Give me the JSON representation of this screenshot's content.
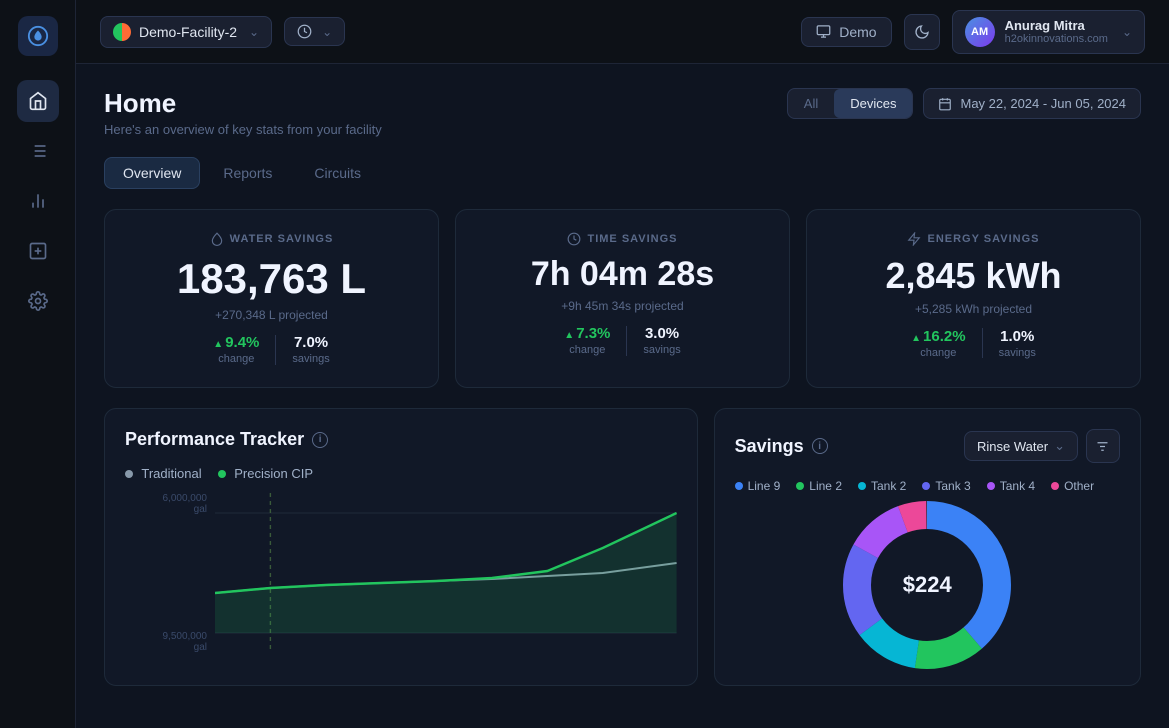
{
  "sidebar": {
    "logo_label": "H2O",
    "items": [
      {
        "name": "home",
        "icon": "home",
        "active": true
      },
      {
        "name": "list",
        "icon": "list",
        "active": false
      },
      {
        "name": "analytics",
        "icon": "bar-chart",
        "active": false
      },
      {
        "name": "add-square",
        "icon": "plus-square",
        "active": false
      },
      {
        "name": "settings",
        "icon": "settings",
        "active": false
      }
    ]
  },
  "topnav": {
    "facility_name": "Demo-Facility-2",
    "history_label": "History",
    "demo_label": "Demo",
    "user_name": "Anurag Mitra",
    "user_email": "h2okinnovations.com",
    "user_initials": "AM"
  },
  "page": {
    "title": "Home",
    "subtitle": "Here's an overview of key stats from your facility"
  },
  "filter": {
    "all_label": "All",
    "devices_label": "Devices",
    "date_range": "May 22, 2024 - Jun 05, 2024"
  },
  "tabs": [
    {
      "label": "Overview",
      "active": true
    },
    {
      "label": "Reports",
      "active": false
    },
    {
      "label": "Circuits",
      "active": false
    }
  ],
  "stats": {
    "water": {
      "icon_label": "droplet-icon",
      "label": "WATER SAVINGS",
      "value": "183,763 L",
      "projected": "+270,348 L projected",
      "change_value": "9.4%",
      "change_label": "change",
      "savings_value": "7.0%",
      "savings_label": "savings"
    },
    "time": {
      "icon_label": "clock-icon",
      "label": "TIME SAVINGS",
      "value": "7h 04m 28s",
      "projected": "+9h 45m 34s projected",
      "change_value": "7.3%",
      "change_label": "change",
      "savings_value": "3.0%",
      "savings_label": "savings"
    },
    "energy": {
      "icon_label": "zap-icon",
      "label": "ENERGY SAVINGS",
      "value": "2,845 kWh",
      "projected": "+5,285 kWh projected",
      "change_value": "16.2%",
      "change_label": "change",
      "savings_value": "1.0%",
      "savings_label": "savings"
    }
  },
  "performance_tracker": {
    "title": "Performance Tracker",
    "legend": [
      {
        "label": "Traditional",
        "color": "#8899aa"
      },
      {
        "label": "Precision CIP",
        "color": "#22c55e"
      }
    ],
    "y_labels": [
      "6,000,000\ngal",
      "9,500,000\ngal"
    ]
  },
  "savings": {
    "title": "Savings",
    "dropdown_label": "Rinse Water",
    "legend_items": [
      {
        "label": "Line 9",
        "color": "#3b82f6"
      },
      {
        "label": "Line 2",
        "color": "#22c55e"
      },
      {
        "label": "Tank 2",
        "color": "#06b6d4"
      },
      {
        "label": "Tank 3",
        "color": "#6366f1"
      },
      {
        "label": "Tank 4",
        "color": "#a855f7"
      },
      {
        "label": "Other",
        "color": "#ec4899"
      }
    ],
    "donut_value": "$224"
  }
}
